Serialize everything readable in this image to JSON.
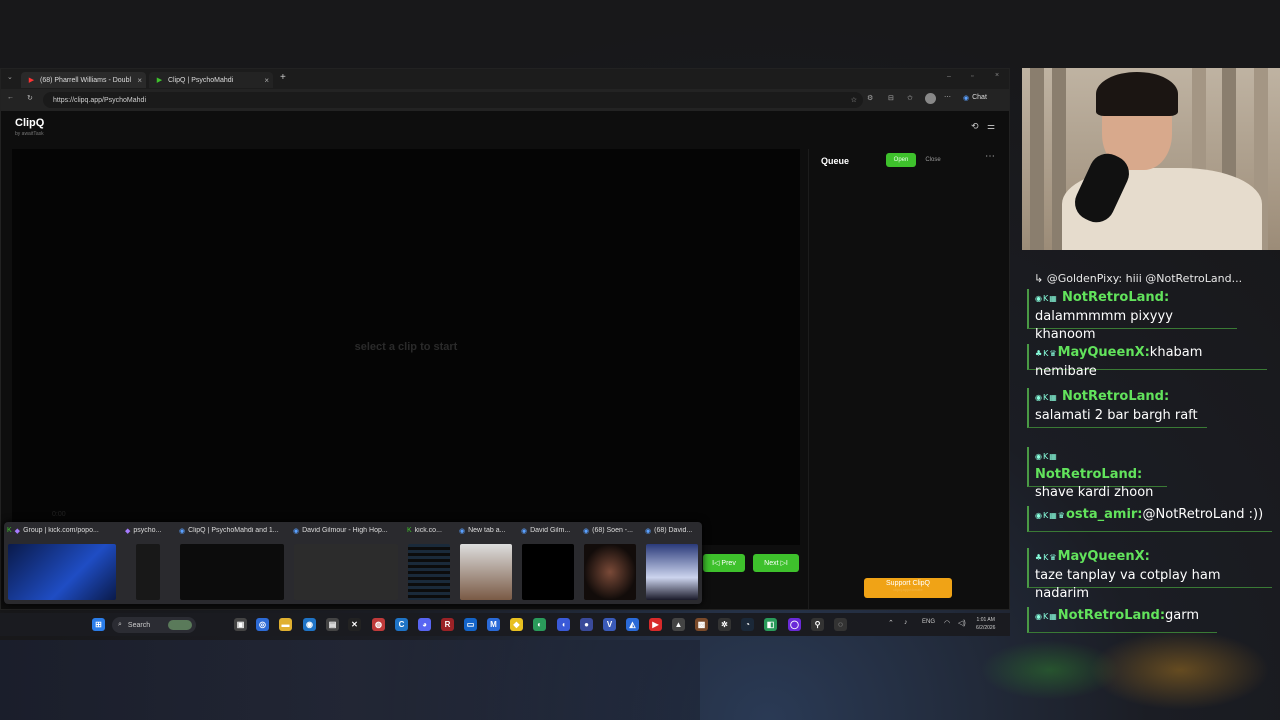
{
  "browser": {
    "tabs": [
      {
        "label": "(68) Pharrell Williams - Doubl"
      },
      {
        "label": "ClipQ | PsychoMahdi"
      }
    ],
    "url": "https://clipq.app/PsychoMahdi",
    "chat_label": "Chat"
  },
  "app": {
    "title": "ClipQ",
    "subtitle": "by awaitTask",
    "placeholder": "select a clip to start",
    "player_time": "0:00",
    "prev_label": "I◁ Prev",
    "next_label": "Next ▷I",
    "queue": {
      "title": "Queue",
      "open_label": "Open",
      "close_label": "Close"
    },
    "support_label": "Support ClipQ",
    "support_url": "clipq.app/donate"
  },
  "previews": [
    "Group | kick.com/popo...",
    "psycho...",
    "ClipQ | PsychoMahdi and 1...",
    "David Gilmour - High Hop...",
    "kick.co...",
    "New tab a...",
    "David Gilm...",
    "(68) Soen -...",
    "(68) David..."
  ],
  "taskbar": {
    "search_label": "Search",
    "language": "ENG",
    "time": "1:01 AM",
    "date": "6/2/2026"
  },
  "chat": {
    "reply_preview": "↳ @GoldenPixy: hiii @NotRetroLand...",
    "messages": [
      {
        "user": "NotRetroLand:",
        "text": "dalammmmm pixyyy khanoom"
      },
      {
        "user": "MayQueenX:",
        "text": "khabam nemibare"
      },
      {
        "user": "NotRetroLand:",
        "text": "salamati 2 bar bargh raft"
      },
      {
        "user": "NotRetroLand:",
        "text": "shave kardi zhoon"
      },
      {
        "user": "osta_amir:",
        "text": "@NotRetroLand :))"
      },
      {
        "user": "MayQueenX:",
        "text": "taze tanplay va cotplay ham nadarim"
      },
      {
        "user": "NotRetroLand:",
        "text": "garm"
      }
    ]
  }
}
